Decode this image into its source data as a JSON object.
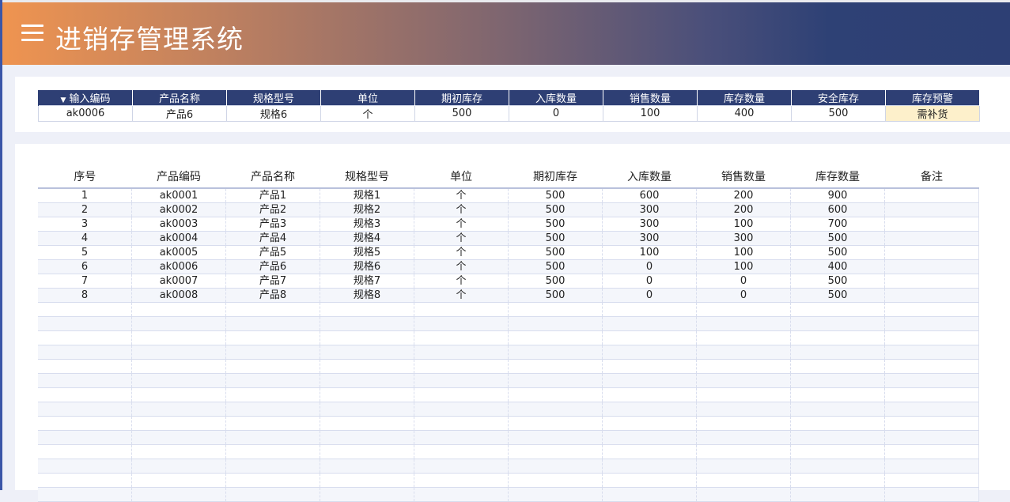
{
  "header": {
    "title": "进销存管理系统",
    "menu_icon": "hamburger-menu-icon"
  },
  "lookup": {
    "columns": [
      "输入编码",
      "产品名称",
      "规格型号",
      "单位",
      "期初库存",
      "入库数量",
      "销售数量",
      "库存数量",
      "安全库存",
      "库存预警"
    ],
    "row": [
      "ak0006",
      "产品6",
      "规格6",
      "个",
      "500",
      "0",
      "100",
      "400",
      "500",
      "需补货"
    ],
    "colors": {
      "header_bg": "#2e3f74",
      "alert_bg": "#fdf0cb"
    }
  },
  "inventory": {
    "columns": [
      "序号",
      "产品编码",
      "产品名称",
      "规格型号",
      "单位",
      "期初库存",
      "入库数量",
      "销售数量",
      "库存数量",
      "备注"
    ],
    "rows": [
      [
        "1",
        "ak0001",
        "产品1",
        "规格1",
        "个",
        "500",
        "600",
        "200",
        "900",
        ""
      ],
      [
        "2",
        "ak0002",
        "产品2",
        "规格2",
        "个",
        "500",
        "300",
        "200",
        "600",
        ""
      ],
      [
        "3",
        "ak0003",
        "产品3",
        "规格3",
        "个",
        "500",
        "300",
        "100",
        "700",
        ""
      ],
      [
        "4",
        "ak0004",
        "产品4",
        "规格4",
        "个",
        "500",
        "300",
        "300",
        "500",
        ""
      ],
      [
        "5",
        "ak0005",
        "产品5",
        "规格5",
        "个",
        "500",
        "100",
        "100",
        "500",
        ""
      ],
      [
        "6",
        "ak0006",
        "产品6",
        "规格6",
        "个",
        "500",
        "0",
        "100",
        "400",
        ""
      ],
      [
        "7",
        "ak0007",
        "产品7",
        "规格7",
        "个",
        "500",
        "0",
        "0",
        "500",
        ""
      ],
      [
        "8",
        "ak0008",
        "产品8",
        "规格8",
        "个",
        "500",
        "0",
        "0",
        "500",
        ""
      ]
    ],
    "empty_rows": 14
  }
}
